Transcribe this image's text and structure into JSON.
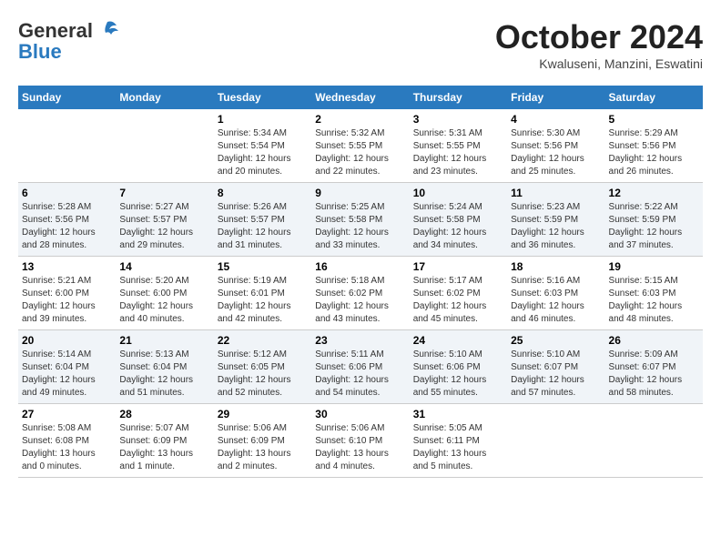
{
  "logo": {
    "line1": "General",
    "line2": "Blue"
  },
  "title": "October 2024",
  "location": "Kwaluseni, Manzini, Eswatini",
  "days_of_week": [
    "Sunday",
    "Monday",
    "Tuesday",
    "Wednesday",
    "Thursday",
    "Friday",
    "Saturday"
  ],
  "weeks": [
    [
      {
        "day": "",
        "info": ""
      },
      {
        "day": "",
        "info": ""
      },
      {
        "day": "1",
        "info": "Sunrise: 5:34 AM\nSunset: 5:54 PM\nDaylight: 12 hours\nand 20 minutes."
      },
      {
        "day": "2",
        "info": "Sunrise: 5:32 AM\nSunset: 5:55 PM\nDaylight: 12 hours\nand 22 minutes."
      },
      {
        "day": "3",
        "info": "Sunrise: 5:31 AM\nSunset: 5:55 PM\nDaylight: 12 hours\nand 23 minutes."
      },
      {
        "day": "4",
        "info": "Sunrise: 5:30 AM\nSunset: 5:56 PM\nDaylight: 12 hours\nand 25 minutes."
      },
      {
        "day": "5",
        "info": "Sunrise: 5:29 AM\nSunset: 5:56 PM\nDaylight: 12 hours\nand 26 minutes."
      }
    ],
    [
      {
        "day": "6",
        "info": "Sunrise: 5:28 AM\nSunset: 5:56 PM\nDaylight: 12 hours\nand 28 minutes."
      },
      {
        "day": "7",
        "info": "Sunrise: 5:27 AM\nSunset: 5:57 PM\nDaylight: 12 hours\nand 29 minutes."
      },
      {
        "day": "8",
        "info": "Sunrise: 5:26 AM\nSunset: 5:57 PM\nDaylight: 12 hours\nand 31 minutes."
      },
      {
        "day": "9",
        "info": "Sunrise: 5:25 AM\nSunset: 5:58 PM\nDaylight: 12 hours\nand 33 minutes."
      },
      {
        "day": "10",
        "info": "Sunrise: 5:24 AM\nSunset: 5:58 PM\nDaylight: 12 hours\nand 34 minutes."
      },
      {
        "day": "11",
        "info": "Sunrise: 5:23 AM\nSunset: 5:59 PM\nDaylight: 12 hours\nand 36 minutes."
      },
      {
        "day": "12",
        "info": "Sunrise: 5:22 AM\nSunset: 5:59 PM\nDaylight: 12 hours\nand 37 minutes."
      }
    ],
    [
      {
        "day": "13",
        "info": "Sunrise: 5:21 AM\nSunset: 6:00 PM\nDaylight: 12 hours\nand 39 minutes."
      },
      {
        "day": "14",
        "info": "Sunrise: 5:20 AM\nSunset: 6:00 PM\nDaylight: 12 hours\nand 40 minutes."
      },
      {
        "day": "15",
        "info": "Sunrise: 5:19 AM\nSunset: 6:01 PM\nDaylight: 12 hours\nand 42 minutes."
      },
      {
        "day": "16",
        "info": "Sunrise: 5:18 AM\nSunset: 6:02 PM\nDaylight: 12 hours\nand 43 minutes."
      },
      {
        "day": "17",
        "info": "Sunrise: 5:17 AM\nSunset: 6:02 PM\nDaylight: 12 hours\nand 45 minutes."
      },
      {
        "day": "18",
        "info": "Sunrise: 5:16 AM\nSunset: 6:03 PM\nDaylight: 12 hours\nand 46 minutes."
      },
      {
        "day": "19",
        "info": "Sunrise: 5:15 AM\nSunset: 6:03 PM\nDaylight: 12 hours\nand 48 minutes."
      }
    ],
    [
      {
        "day": "20",
        "info": "Sunrise: 5:14 AM\nSunset: 6:04 PM\nDaylight: 12 hours\nand 49 minutes."
      },
      {
        "day": "21",
        "info": "Sunrise: 5:13 AM\nSunset: 6:04 PM\nDaylight: 12 hours\nand 51 minutes."
      },
      {
        "day": "22",
        "info": "Sunrise: 5:12 AM\nSunset: 6:05 PM\nDaylight: 12 hours\nand 52 minutes."
      },
      {
        "day": "23",
        "info": "Sunrise: 5:11 AM\nSunset: 6:06 PM\nDaylight: 12 hours\nand 54 minutes."
      },
      {
        "day": "24",
        "info": "Sunrise: 5:10 AM\nSunset: 6:06 PM\nDaylight: 12 hours\nand 55 minutes."
      },
      {
        "day": "25",
        "info": "Sunrise: 5:10 AM\nSunset: 6:07 PM\nDaylight: 12 hours\nand 57 minutes."
      },
      {
        "day": "26",
        "info": "Sunrise: 5:09 AM\nSunset: 6:07 PM\nDaylight: 12 hours\nand 58 minutes."
      }
    ],
    [
      {
        "day": "27",
        "info": "Sunrise: 5:08 AM\nSunset: 6:08 PM\nDaylight: 13 hours\nand 0 minutes."
      },
      {
        "day": "28",
        "info": "Sunrise: 5:07 AM\nSunset: 6:09 PM\nDaylight: 13 hours\nand 1 minute."
      },
      {
        "day": "29",
        "info": "Sunrise: 5:06 AM\nSunset: 6:09 PM\nDaylight: 13 hours\nand 2 minutes."
      },
      {
        "day": "30",
        "info": "Sunrise: 5:06 AM\nSunset: 6:10 PM\nDaylight: 13 hours\nand 4 minutes."
      },
      {
        "day": "31",
        "info": "Sunrise: 5:05 AM\nSunset: 6:11 PM\nDaylight: 13 hours\nand 5 minutes."
      },
      {
        "day": "",
        "info": ""
      },
      {
        "day": "",
        "info": ""
      }
    ]
  ]
}
